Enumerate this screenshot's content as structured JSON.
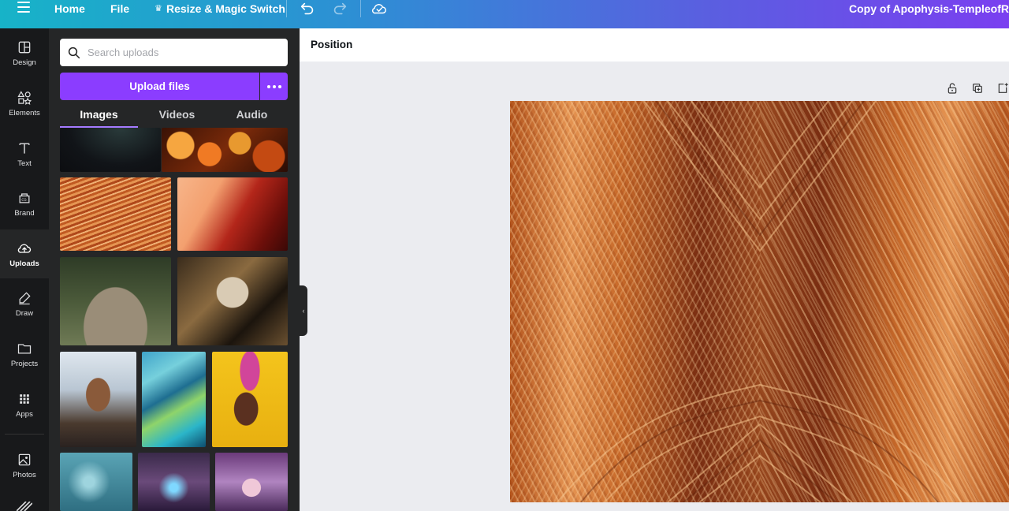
{
  "topbar": {
    "home_label": "Home",
    "file_label": "File",
    "resize_label": "Resize & Magic Switch",
    "doc_title": "Copy of Apophysis-TempleofR",
    "gradient_start": "#17b3c8",
    "gradient_end": "#7a3ff0"
  },
  "rail": {
    "items": [
      {
        "label": "Design",
        "icon": "layout-icon"
      },
      {
        "label": "Elements",
        "icon": "shapes-icon"
      },
      {
        "label": "Text",
        "icon": "text-T-icon"
      },
      {
        "label": "Brand",
        "icon": "brand-icon"
      },
      {
        "label": "Uploads",
        "icon": "cloud-upload-icon",
        "active": true
      },
      {
        "label": "Draw",
        "icon": "pen-icon"
      },
      {
        "label": "Projects",
        "icon": "folder-icon"
      },
      {
        "label": "Apps",
        "icon": "grid-icon"
      },
      {
        "label": "Photos",
        "icon": "image-icon"
      }
    ]
  },
  "panel": {
    "search_placeholder": "Search uploads",
    "upload_label": "Upload files",
    "tabs": [
      "Images",
      "Videos",
      "Audio"
    ],
    "active_tab": "Images",
    "accent": "#8b3dff"
  },
  "editor": {
    "toolbar_label": "Position"
  }
}
